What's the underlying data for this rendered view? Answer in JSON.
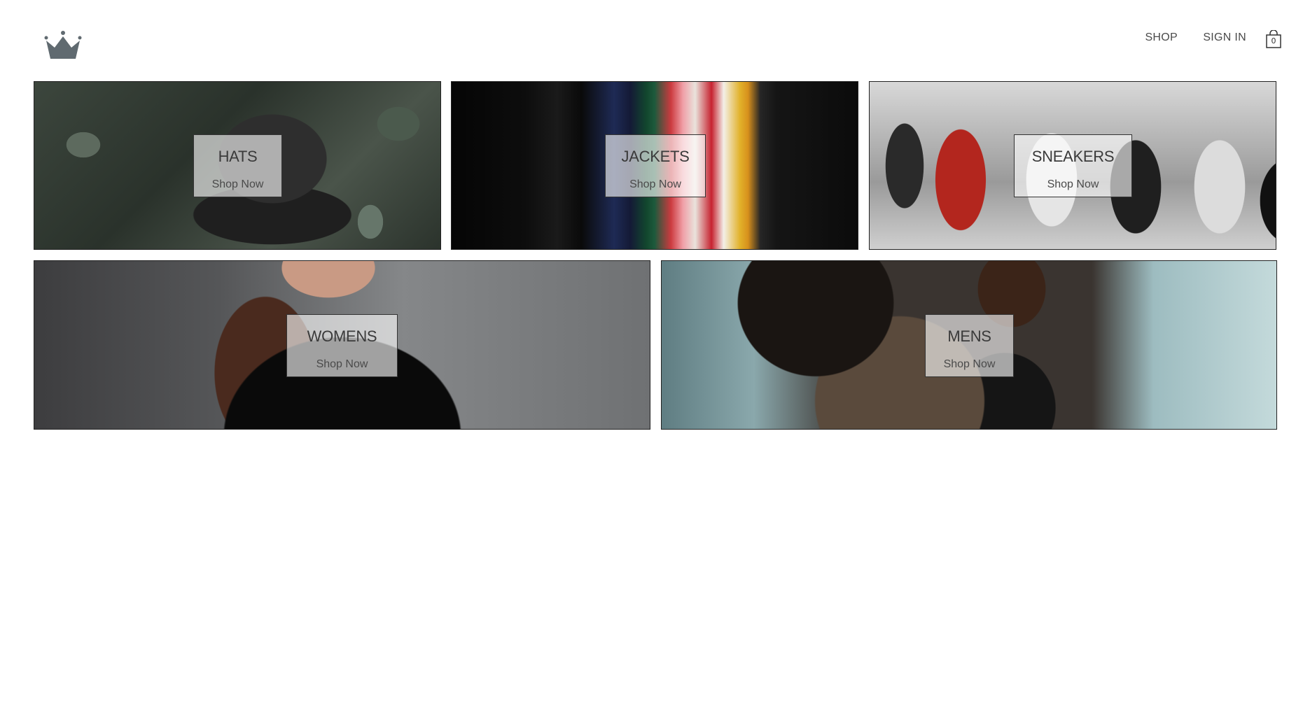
{
  "header": {
    "logo_icon": "crown-icon",
    "nav": {
      "shop": "SHOP",
      "sign_in": "SIGN IN"
    },
    "cart": {
      "icon": "shopping-bag-icon",
      "count": "0"
    }
  },
  "categories": [
    {
      "title": "HATS",
      "cta": "Shop Now"
    },
    {
      "title": "JACKETS",
      "cta": "Shop Now"
    },
    {
      "title": "SNEAKERS",
      "cta": "Shop Now"
    },
    {
      "title": "WOMENS",
      "cta": "Shop Now"
    },
    {
      "title": "MENS",
      "cta": "Shop Now"
    }
  ]
}
